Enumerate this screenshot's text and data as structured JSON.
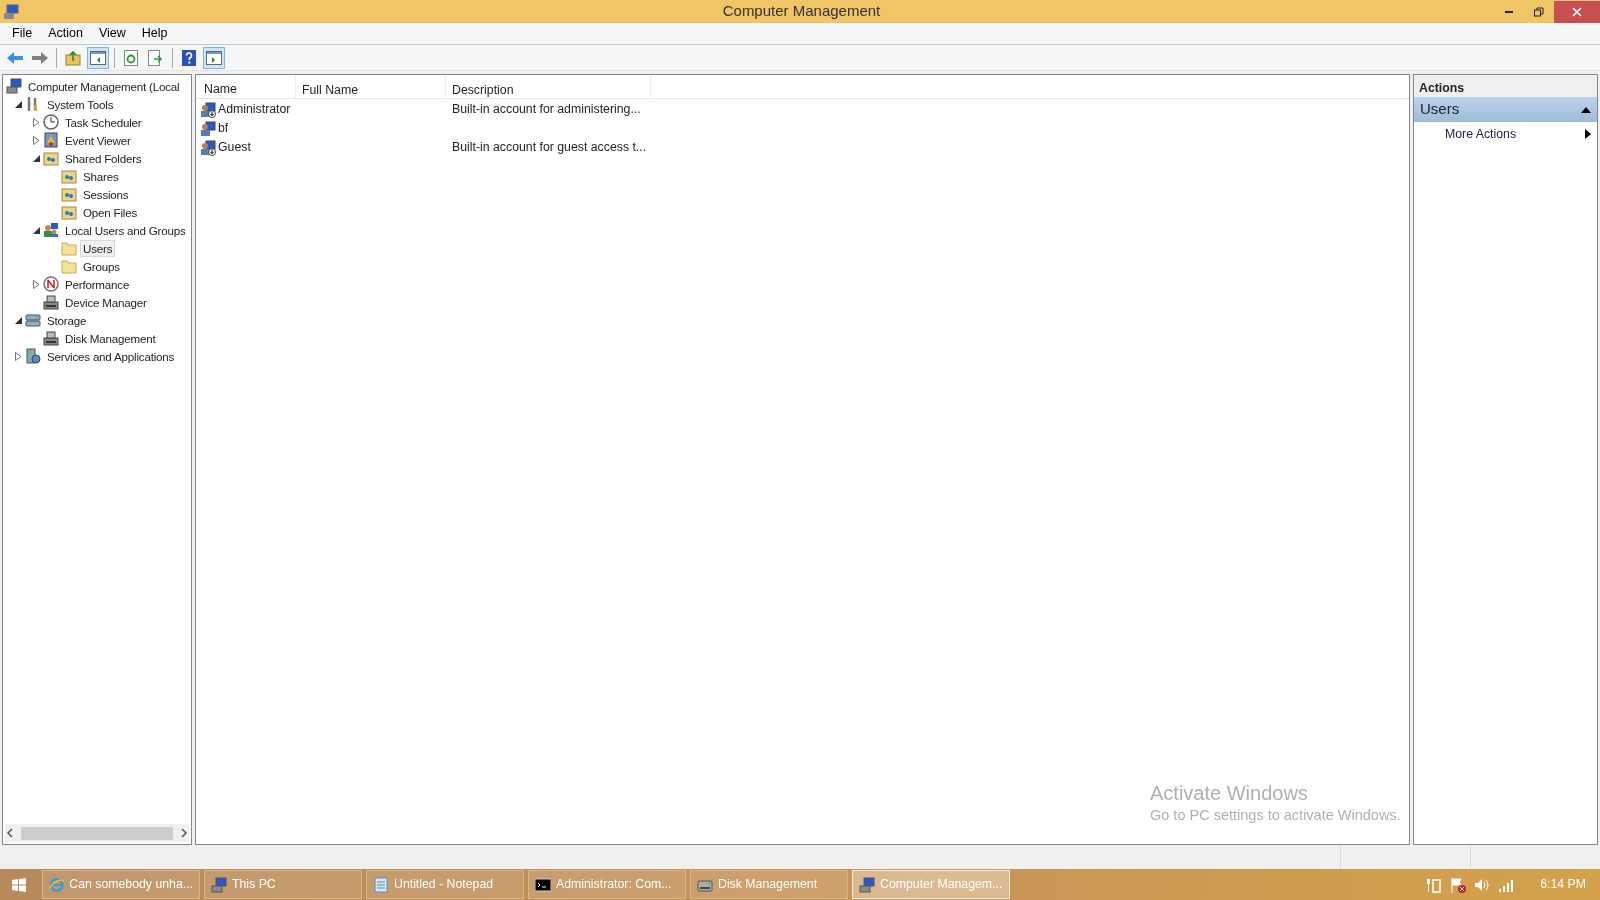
{
  "window": {
    "title": "Computer Management"
  },
  "menu": [
    "File",
    "Action",
    "View",
    "Help"
  ],
  "tree": [
    {
      "label": "Computer Management (Local",
      "kind": "computer",
      "selected": false,
      "children": [
        {
          "label": "System Tools",
          "kind": "tools",
          "selected": false,
          "expanded": true,
          "children": [
            {
              "label": "Task Scheduler",
              "kind": "clock",
              "selected": false,
              "expanded": false
            },
            {
              "label": "Event Viewer",
              "kind": "log",
              "selected": false,
              "expanded": false
            },
            {
              "label": "Shared Folders",
              "kind": "share",
              "selected": false,
              "expanded": true,
              "children": [
                {
                  "label": "Shares",
                  "kind": "share",
                  "selected": false
                },
                {
                  "label": "Sessions",
                  "kind": "share",
                  "selected": false
                },
                {
                  "label": "Open Files",
                  "kind": "share",
                  "selected": false
                }
              ]
            },
            {
              "label": "Local Users and Groups",
              "kind": "users",
              "selected": false,
              "expanded": true,
              "children": [
                {
                  "label": "Users",
                  "kind": "folder",
                  "selected": true
                },
                {
                  "label": "Groups",
                  "kind": "folder",
                  "selected": false
                }
              ]
            },
            {
              "label": "Performance",
              "kind": "gauge",
              "selected": false,
              "expanded": false
            },
            {
              "label": "Device Manager",
              "kind": "device",
              "selected": false
            }
          ]
        },
        {
          "label": "Storage",
          "kind": "storage",
          "selected": false,
          "expanded": true,
          "children": [
            {
              "label": "Disk Management",
              "kind": "device",
              "selected": false
            }
          ]
        },
        {
          "label": "Services and Applications",
          "kind": "services",
          "selected": false,
          "expanded": false
        }
      ]
    }
  ],
  "table": {
    "columns": [
      "Name",
      "Full Name",
      "Description"
    ],
    "rows": [
      {
        "name": "Administrator",
        "description": "Built-in account for administering...",
        "disabled": true
      },
      {
        "name": "bf",
        "disabled": false
      },
      {
        "name": "Guest",
        "description": "Built-in account for guest access t...",
        "disabled": true
      }
    ]
  },
  "actions": {
    "title": "Actions",
    "section": "Users",
    "items": [
      "More Actions"
    ]
  },
  "overlay": {
    "title": "Activate Windows",
    "text": "Go to PC settings to activate Windows."
  },
  "taskbar": [
    {
      "label": "Can somebody unha...",
      "kind": "browser",
      "selected": false
    },
    {
      "label": "This PC",
      "kind": "computer",
      "selected": false
    },
    {
      "label": "Untitled - Notepad",
      "kind": "notepad",
      "selected": false
    },
    {
      "label": "Administrator: Com...",
      "kind": "console",
      "selected": false
    },
    {
      "label": "Disk Management",
      "kind": "disk",
      "selected": false
    },
    {
      "label": "Computer Managem...",
      "kind": "computer",
      "selected": true
    }
  ],
  "clock": "6:14 PM"
}
